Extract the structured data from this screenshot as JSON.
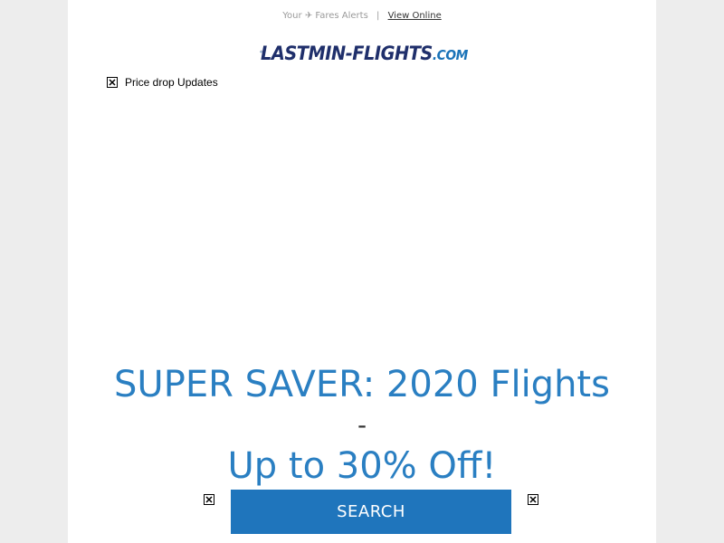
{
  "header": {
    "tagline_prefix": "Your",
    "tagline_plane": "✈",
    "tagline_suffix": "Fares Alerts",
    "separator": "|",
    "view_online_label": "View Online"
  },
  "logo": {
    "brand": "LASTMIN-FLIGHTS",
    "suffix": ".COM"
  },
  "image_alt": {
    "price_drop": "Price drop Updates"
  },
  "promo": {
    "line1": "SUPER SAVER: 2020 Flights",
    "dash": "-",
    "line2": "Up to 30% Off!"
  },
  "cta": {
    "search_label": "SEARCH"
  },
  "colors": {
    "page_bg": "#ededed",
    "card_bg": "#ffffff",
    "headline": "#2a7fc2",
    "button": "#1f75bc",
    "logo_navy": "#1f2f6b"
  }
}
